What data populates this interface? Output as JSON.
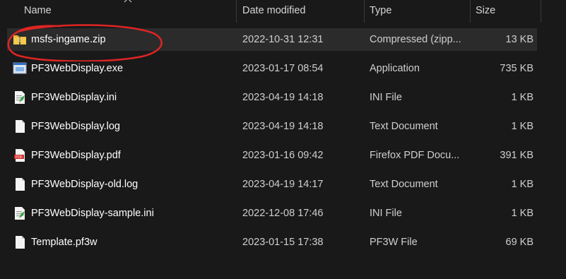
{
  "columns": {
    "name": "Name",
    "date": "Date modified",
    "type": "Type",
    "size": "Size"
  },
  "files": [
    {
      "name": "msfs-ingame.zip",
      "date": "2022-10-31 12:31",
      "type": "Compressed (zipp...",
      "size": "13 KB",
      "icon": "zip-folder-icon"
    },
    {
      "name": "PF3WebDisplay.exe",
      "date": "2023-01-17 08:54",
      "type": "Application",
      "size": "735 KB",
      "icon": "application-icon"
    },
    {
      "name": "PF3WebDisplay.ini",
      "date": "2023-04-19 14:18",
      "type": "INI File",
      "size": "1 KB",
      "icon": "ini-file-icon"
    },
    {
      "name": "PF3WebDisplay.log",
      "date": "2023-04-19 14:18",
      "type": "Text Document",
      "size": "1 KB",
      "icon": "text-file-icon"
    },
    {
      "name": "PF3WebDisplay.pdf",
      "date": "2023-01-16 09:42",
      "type": "Firefox PDF Docu...",
      "size": "391 KB",
      "icon": "pdf-file-icon"
    },
    {
      "name": "PF3WebDisplay-old.log",
      "date": "2023-04-19 14:17",
      "type": "Text Document",
      "size": "1 KB",
      "icon": "text-file-icon"
    },
    {
      "name": "PF3WebDisplay-sample.ini",
      "date": "2022-12-08 17:46",
      "type": "INI File",
      "size": "1 KB",
      "icon": "ini-file-icon"
    },
    {
      "name": "Template.pf3w",
      "date": "2023-01-15 17:38",
      "type": "PF3W File",
      "size": "69 KB",
      "icon": "generic-file-icon"
    }
  ],
  "colors": {
    "background": "#191919",
    "selected_row": "#2b2b2b",
    "annotation": "#e02424"
  }
}
